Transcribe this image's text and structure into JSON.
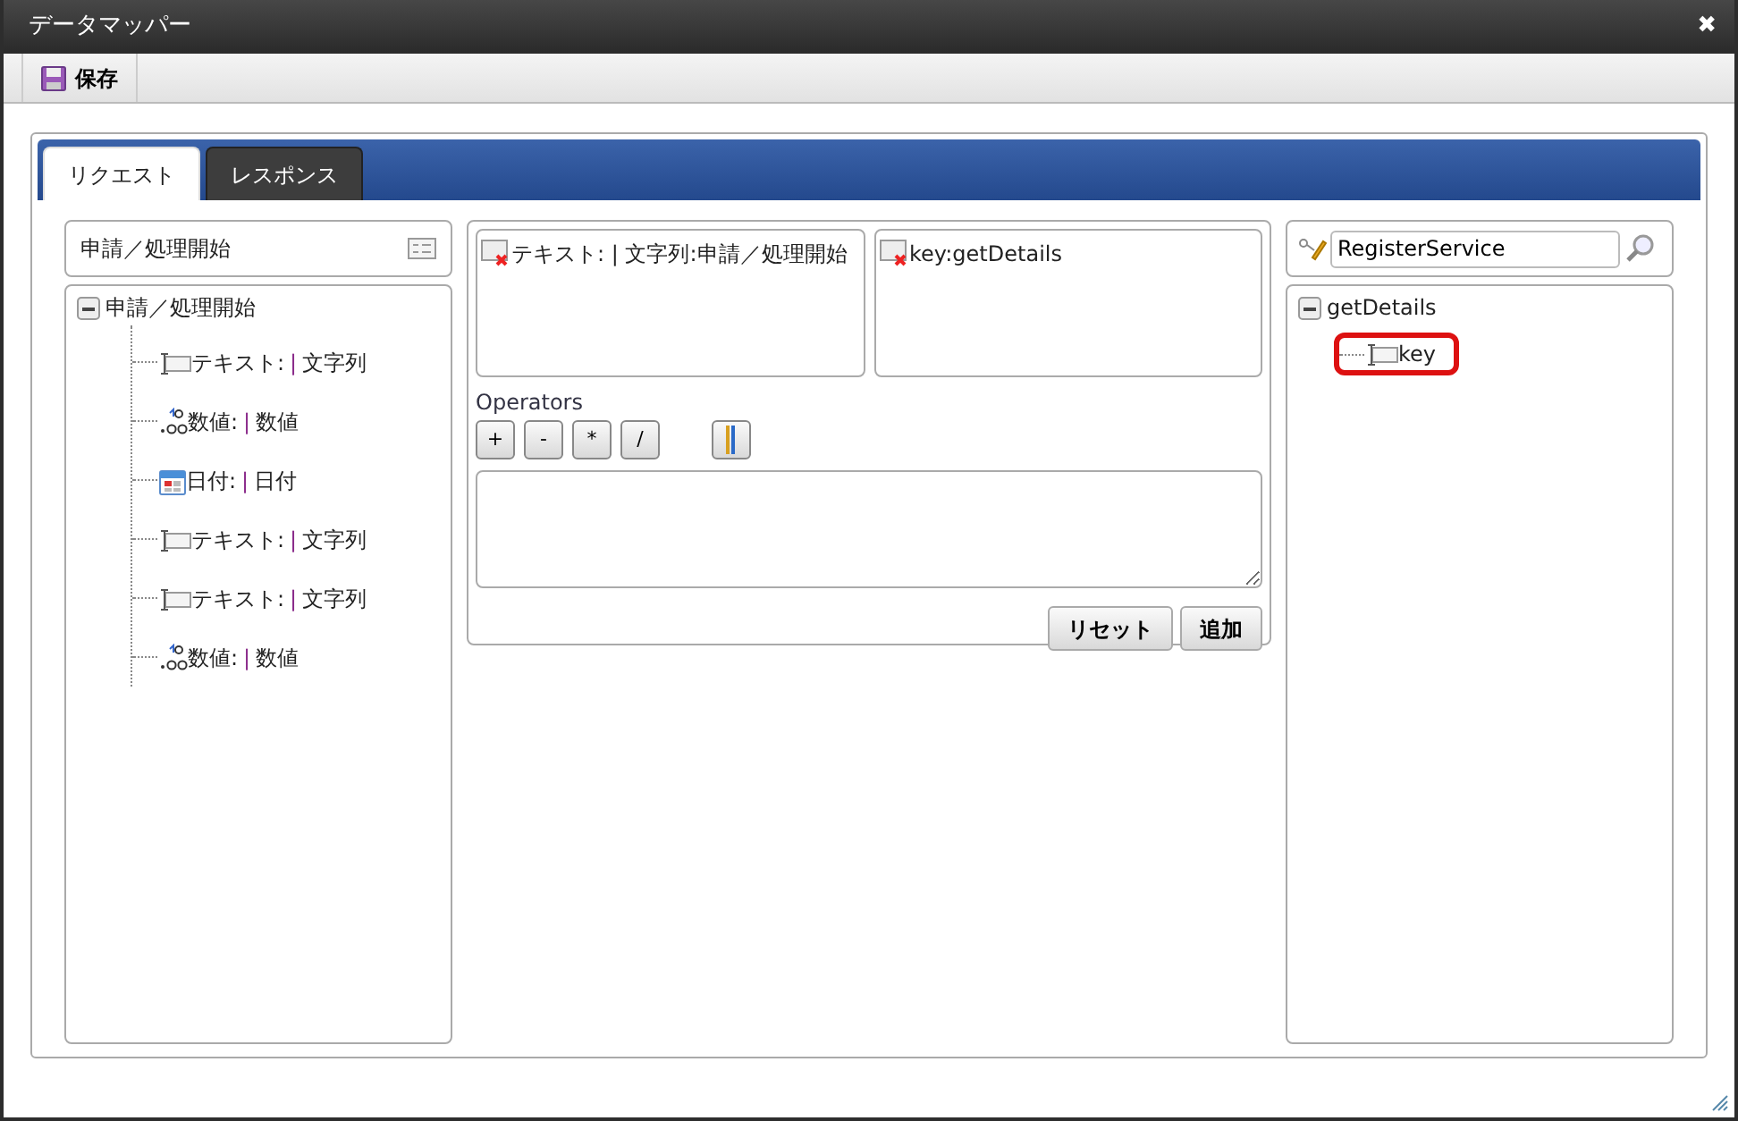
{
  "window": {
    "title": "データマッパー",
    "close": "✖"
  },
  "toolbar": {
    "save_label": "保存"
  },
  "tabs": [
    {
      "label": "リクエスト",
      "selected": true
    },
    {
      "label": "レスポンス",
      "selected": false
    }
  ],
  "source_panel": {
    "header": "申請／処理開始",
    "tree": {
      "label": "申請／処理開始",
      "expanded": true,
      "children": [
        {
          "kind": "text",
          "name": "テキスト:",
          "separator": "|",
          "type": "文字列"
        },
        {
          "kind": "number",
          "name": "数値:",
          "separator": "|",
          "type": "数値"
        },
        {
          "kind": "date",
          "name": "日付:",
          "separator": "|",
          "type": "日付"
        },
        {
          "kind": "text",
          "name": "テキスト:",
          "separator": "|",
          "type": "文字列"
        },
        {
          "kind": "text",
          "name": "テキスト:",
          "separator": "|",
          "type": "文字列"
        },
        {
          "kind": "number",
          "name": "数値:",
          "separator": "|",
          "type": "数値"
        }
      ]
    }
  },
  "mapping_panel": {
    "source_item": "テキスト: | 文字列:申請／処理開始",
    "target_item": "key:getDetails",
    "operators_label": "Operators",
    "operators": [
      {
        "kind": "text",
        "label": "+"
      },
      {
        "kind": "text",
        "label": "-"
      },
      {
        "kind": "text",
        "label": "*"
      },
      {
        "kind": "text",
        "label": "/"
      },
      {
        "kind": "icon"
      }
    ],
    "reset_button": "リセット",
    "add_button": "追加"
  },
  "target_panel": {
    "search_value": "RegisterService",
    "tree": {
      "label": "getDetails",
      "expanded": true,
      "children": [
        {
          "kind": "text",
          "label": "key",
          "selected": true
        }
      ]
    }
  }
}
